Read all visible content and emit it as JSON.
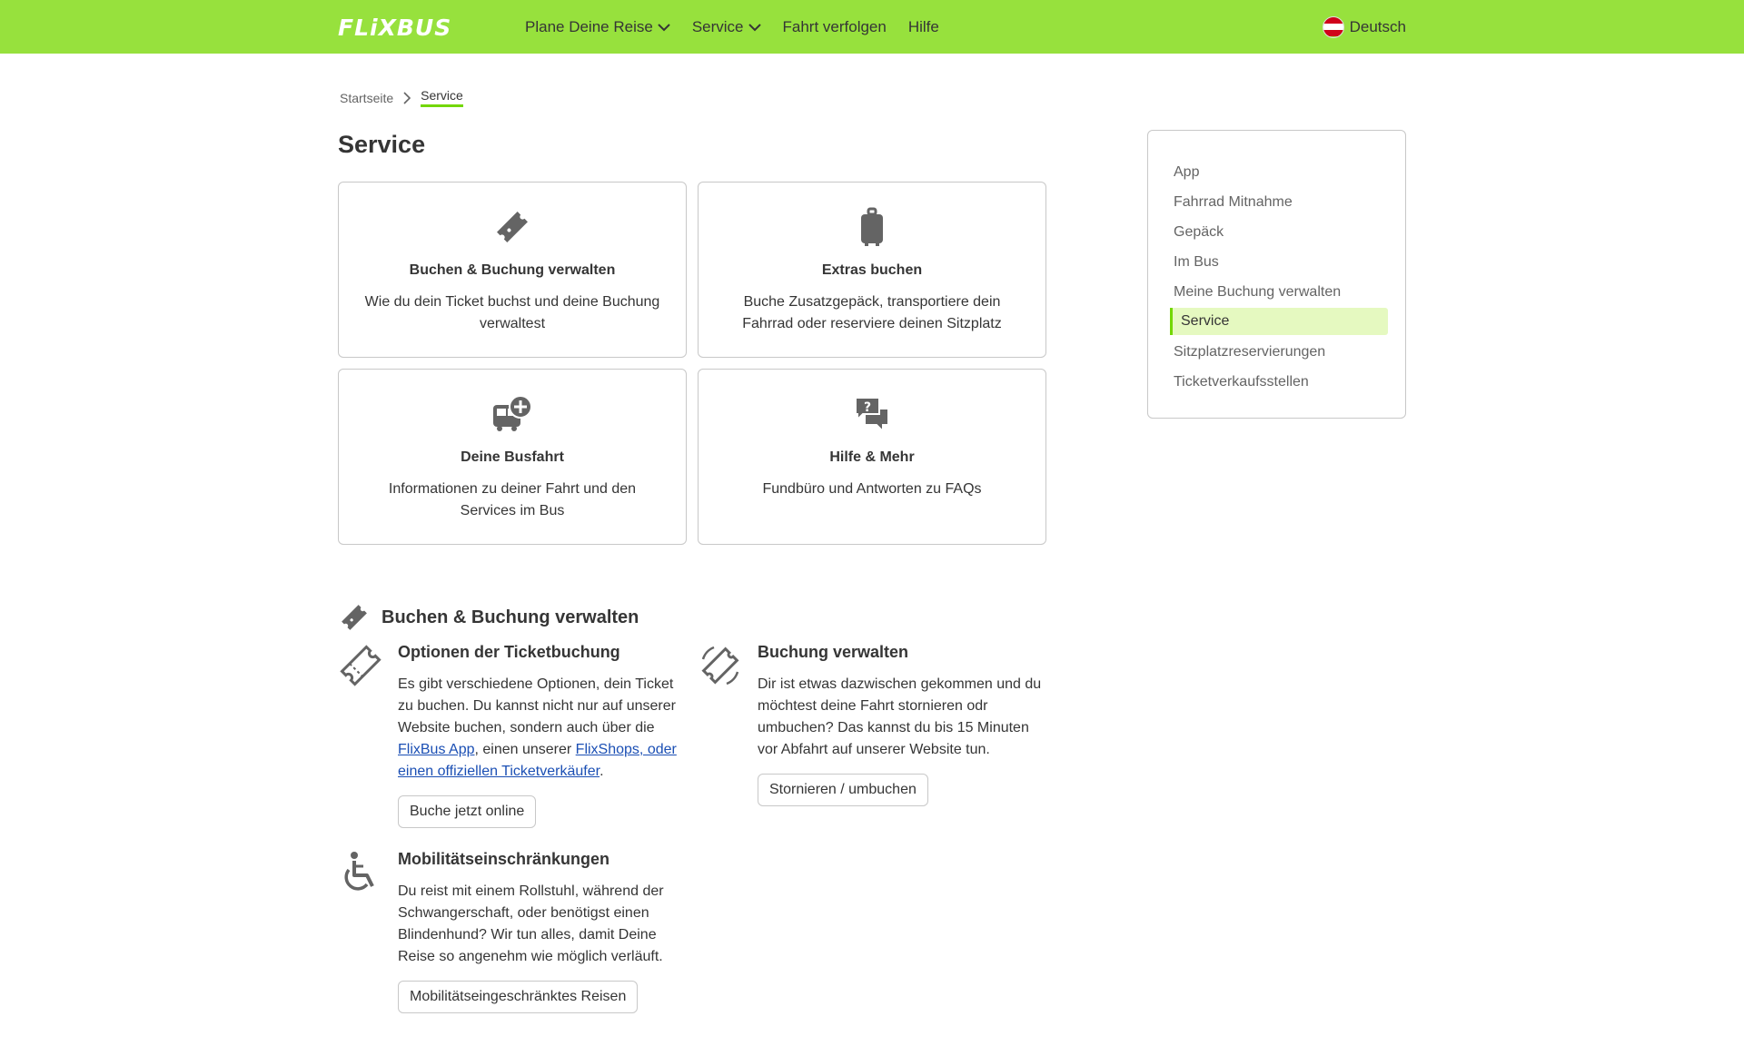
{
  "header": {
    "logo": "FLiXBUS",
    "nav": [
      {
        "label": "Plane Deine Reise",
        "dropdown": true
      },
      {
        "label": "Service",
        "dropdown": true
      },
      {
        "label": "Fahrt verfolgen",
        "dropdown": false
      },
      {
        "label": "Hilfe",
        "dropdown": false
      }
    ],
    "language": "Deutsch"
  },
  "breadcrumb": {
    "home": "Startseite",
    "current": "Service"
  },
  "page_title": "Service",
  "cards": [
    {
      "icon": "ticket-icon",
      "title": "Buchen & Buchung verwalten",
      "desc": "Wie du dein Ticket buchst und deine Buchung verwaltest"
    },
    {
      "icon": "luggage-icon",
      "title": "Extras buchen",
      "desc": "Buche Zusatzgepäck, transportiere dein Fahrrad oder reserviere deinen Sitzplatz"
    },
    {
      "icon": "bus-plus-icon",
      "title": "Deine Busfahrt",
      "desc": "Informationen zu deiner Fahrt und den Services im Bus"
    },
    {
      "icon": "help-chat-icon",
      "title": "Hilfe & Mehr",
      "desc": "Fundbüro und Antworten zu FAQs"
    }
  ],
  "sidebar": {
    "items": [
      {
        "label": "App"
      },
      {
        "label": "Fahrrad Mitnahme"
      },
      {
        "label": "Gepäck"
      },
      {
        "label": "Im Bus"
      },
      {
        "label": "Meine Buchung verwalten"
      },
      {
        "label": "Service",
        "active": true
      },
      {
        "label": "Sitzplatzreservierungen"
      },
      {
        "label": "Ticketverkaufsstellen"
      }
    ]
  },
  "section": {
    "title": "Buchen & Buchung verwalten",
    "blocks": {
      "options": {
        "title": "Optionen der Ticketbuchung",
        "text_1": "Es gibt verschiedene Optionen, dein Ticket zu buchen. Du kannst nicht nur auf unserer Website buchen, sondern auch über die ",
        "link_1": "FlixBus App",
        "text_2": ", einen unserer ",
        "link_2": "FlixShops, oder einen offiziellen Ticketverkäufer",
        "text_3": ".",
        "button": "Buche jetzt online"
      },
      "manage": {
        "title": "Buchung verwalten",
        "text": "Dir ist etwas dazwischen gekommen und du möchtest deine Fahrt stornieren odr umbuchen? Das kannst du bis 15 Minuten vor Abfahrt auf unserer Website tun.",
        "button": "Stornieren / umbuchen"
      },
      "mobility": {
        "title": "Mobilitätseinschränkungen",
        "text": "Du reist mit einem Rollstuhl, während der Schwangerschaft, oder benötigst einen Blindenhund? Wir tun alles, damit Deine Reise so angenehm wie möglich verläuft.",
        "button": "Mobilitätseingeschränktes Reisen"
      }
    }
  },
  "colors": {
    "brand_green": "#97e13d",
    "accent_green": "#73d700",
    "active_bg": "#e5f9c0",
    "link": "#1b4fb4"
  }
}
